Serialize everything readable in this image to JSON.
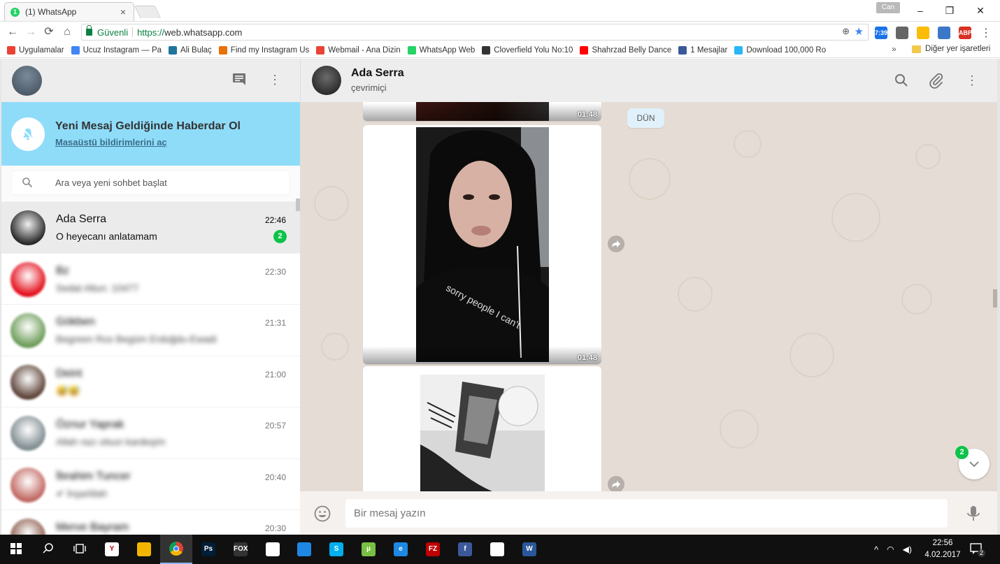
{
  "browser": {
    "tab_title": "(1) WhatsApp",
    "tab_favicon_count": "1",
    "tab_close": "×",
    "profile_name": "Can",
    "window_controls": {
      "minimize": "–",
      "restore": "❐",
      "close": "✕"
    },
    "nav": {
      "back": "←",
      "forward": "→",
      "reload": "⟳",
      "home": "⌂"
    },
    "secure_label": "Güvenli",
    "url_scheme": "https://",
    "url_host": "web.whatsapp.com",
    "extensions": [
      {
        "icon": "calendar-icon",
        "label": "7:39",
        "color": "#1a73e8"
      },
      {
        "icon": "globe-icon",
        "label": "",
        "color": "#666666"
      },
      {
        "icon": "chart-icon",
        "label": "",
        "color": "#fbbc05"
      },
      {
        "icon": "download-icon",
        "label": "",
        "color": "#3b78c8"
      },
      {
        "icon": "adblock-icon",
        "label": "ABP",
        "color": "#d93025"
      }
    ],
    "bookmarks": [
      {
        "label": "Uygulamalar",
        "icon": "apps-icon",
        "color": "#e94235"
      },
      {
        "label": "Ucuz Instagram — Pa",
        "icon": "bookmark-icon",
        "color": "#4285f4"
      },
      {
        "label": "Ali Bulaç",
        "icon": "wordpress-icon",
        "color": "#21759b"
      },
      {
        "label": "Find my Instagram Us",
        "icon": "instagram-icon",
        "color": "#e8710a"
      },
      {
        "label": "Webmail - Ana Dizin",
        "icon": "webmail-icon",
        "color": "#ea4335"
      },
      {
        "label": "WhatsApp Web",
        "icon": "whatsapp-icon",
        "color": "#25d366"
      },
      {
        "label": "Cloverfield Yolu No:10",
        "icon": "film-icon",
        "color": "#333333"
      },
      {
        "label": "Shahrzad Belly Dance",
        "icon": "youtube-icon",
        "color": "#ff0000"
      },
      {
        "label": "1 Mesajlar",
        "icon": "facebook-icon",
        "color": "#3b5998"
      },
      {
        "label": "Download 100,000 Ro",
        "icon": "cloud-icon",
        "color": "#29b6f6"
      }
    ],
    "bookmarks_more": "»",
    "other_bookmarks": "Diğer yer işaretleri"
  },
  "sidebar": {
    "notice_title": "Yeni Mesaj Geldiğinde Haberdar Ol",
    "notice_link": "Masaüstü bildirimlerini aç",
    "search_placeholder": "Ara veya yeni sohbet başlat",
    "chats": [
      {
        "name": "Ada Serra",
        "preview": "O heyecanı anlatamam",
        "time": "22:46",
        "unread": "2",
        "active": true,
        "avatar": "#2b2b2b",
        "blurred": false
      },
      {
        "name": "Bz",
        "preview": "Sedat Altun: 10477",
        "time": "22:30",
        "unread": "",
        "active": false,
        "avatar": "#e30a17",
        "blurred": true
      },
      {
        "name": "Gökben",
        "preview": "Begreen Ros Begüm Erdoğdu-Ewadi",
        "time": "21:31",
        "unread": "",
        "active": false,
        "avatar": "#6a9a55",
        "blurred": true
      },
      {
        "name": "Deint",
        "preview": "😅😅",
        "time": "21:00",
        "unread": "",
        "active": false,
        "avatar": "#5a4035",
        "blurred": true
      },
      {
        "name": "Öznur Yaprak",
        "preview": "Allah razı olsun kardeşim",
        "time": "20:57",
        "unread": "",
        "active": false,
        "avatar": "#7d8a8f",
        "blurred": true
      },
      {
        "name": "İbrahim Tuncer",
        "preview": "✔ İnşaAllah",
        "time": "20:40",
        "unread": "",
        "active": false,
        "avatar": "#c0645e",
        "blurred": true
      },
      {
        "name": "Merve Bayram",
        "preview": "",
        "time": "20:30",
        "unread": "",
        "active": false,
        "avatar": "#8a5a4a",
        "blurred": true
      }
    ]
  },
  "conversation": {
    "contact_name": "Ada Serra",
    "contact_status": "çevrimiçi",
    "day_badge": "DÜN",
    "messages": [
      {
        "type": "image",
        "time": "01:48"
      },
      {
        "type": "image",
        "time": "01:48"
      },
      {
        "type": "image",
        "time": ""
      }
    ],
    "scroll_down_unread": "2",
    "composer_placeholder": "Bir mesaj yazın",
    "colors": {
      "accent_green": "#0cc349",
      "notice_blue": "#8fdcf9",
      "wallpaper": "#e5ddd5"
    }
  },
  "taskbar": {
    "apps": [
      {
        "icon": "windows-start-icon",
        "label": "",
        "color": "transparent"
      },
      {
        "icon": "search-icon",
        "label": "",
        "color": "transparent"
      },
      {
        "icon": "task-view-icon",
        "label": "",
        "color": "transparent"
      },
      {
        "icon": "yandex-icon",
        "label": "Y",
        "color": "#ffffff"
      },
      {
        "icon": "file-explorer-icon",
        "label": "",
        "color": "#f2b600"
      },
      {
        "icon": "chrome-icon",
        "label": "",
        "color": "#dd4b39"
      },
      {
        "icon": "photoshop-icon",
        "label": "Ps",
        "color": "#001e36"
      },
      {
        "icon": "fox-icon",
        "label": "FOX",
        "color": "#333333"
      },
      {
        "icon": "store-icon",
        "label": "",
        "color": "#ffffff"
      },
      {
        "icon": "kaspersky-icon",
        "label": "",
        "color": "#1e88e5"
      },
      {
        "icon": "skype-icon",
        "label": "S",
        "color": "#00aff0"
      },
      {
        "icon": "utorrent-icon",
        "label": "µ",
        "color": "#78c043"
      },
      {
        "icon": "edge-icon",
        "label": "e",
        "color": "#1e88e5"
      },
      {
        "icon": "filezilla-icon",
        "label": "FZ",
        "color": "#bf0000"
      },
      {
        "icon": "facebook-icon",
        "label": "f",
        "color": "#3b5998"
      },
      {
        "icon": "photos-icon",
        "label": "",
        "color": "#ffffff"
      },
      {
        "icon": "word-icon",
        "label": "W",
        "color": "#2b579a"
      }
    ],
    "tray_chevron": "^",
    "clock_time": "22:56",
    "clock_date": "4.02.2017",
    "notification_count": "2"
  }
}
